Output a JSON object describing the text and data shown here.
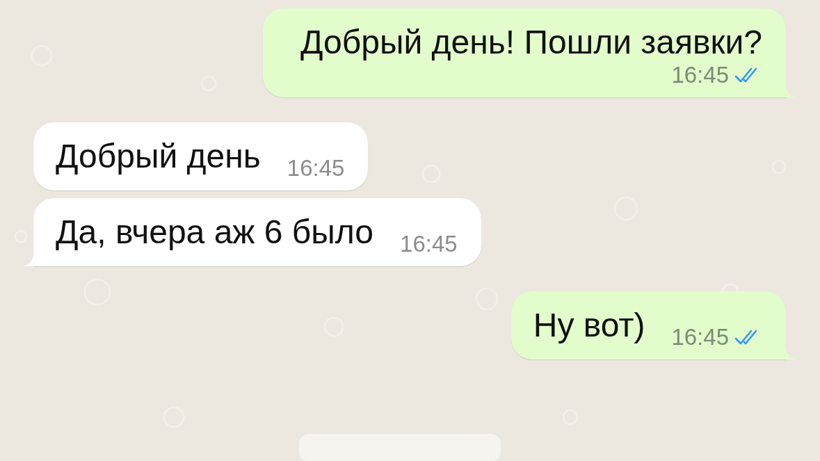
{
  "messages": [
    {
      "kind": "out",
      "text": "Добрый день! Пошли заявки?",
      "time": "16:45",
      "read": true,
      "tail": true
    },
    {
      "kind": "in",
      "text": "Добрый день",
      "time": "16:45",
      "tail": false
    },
    {
      "kind": "in",
      "text": "Да, вчера аж 6 было",
      "time": "16:45",
      "tail": true
    },
    {
      "kind": "out",
      "text": "Ну вот)",
      "time": "16:45",
      "read": true,
      "tail": true
    }
  ]
}
